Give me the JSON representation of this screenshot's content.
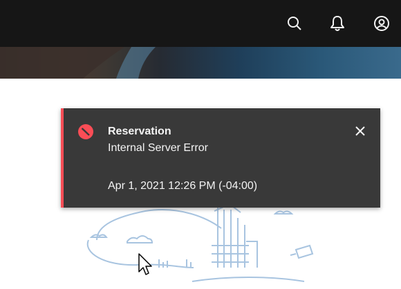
{
  "header": {
    "icons": [
      "search-icon",
      "notification-icon",
      "user-avatar-icon"
    ]
  },
  "notification": {
    "kind": "error",
    "accent_color": "#fa4d56",
    "title": "Reservation",
    "subtitle": "Internal Server Error",
    "caption": "Apr 1, 2021 12:26 PM (-04:00)",
    "close_icon": "close-icon"
  },
  "colors": {
    "header_bg": "#161616",
    "toast_bg": "#393939",
    "illustration_stroke": "#a8c4e0"
  }
}
